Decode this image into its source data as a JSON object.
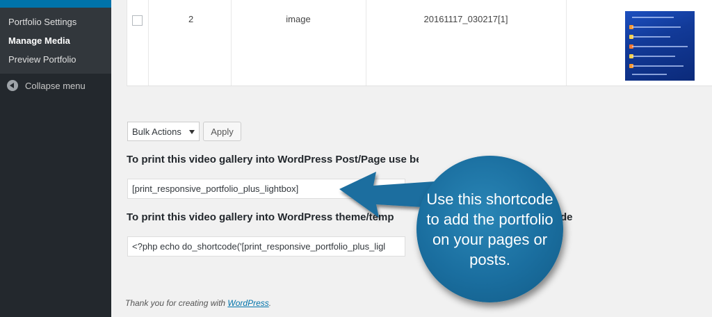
{
  "sidebar": {
    "submenu": [
      {
        "label": "Portfolio Settings",
        "current": false
      },
      {
        "label": "Manage Media",
        "current": true
      },
      {
        "label": "Preview Portfolio",
        "current": false
      }
    ],
    "collapse_label": "Collapse menu"
  },
  "table": {
    "row": {
      "number": "2",
      "type": "image",
      "title": "20161117_030217[1]"
    }
  },
  "bulk": {
    "select_value": "Bulk Actions",
    "apply_label": "Apply"
  },
  "shortcode": {
    "post_heading": "To print this video gallery into WordPress Post/Page use below co",
    "post_code": "[print_responsive_portfolio_plus_lightbox]",
    "theme_heading": "To print this video gallery into WordPress theme/temp",
    "theme_heading_tail": "de",
    "theme_code": "<?php echo do_shortcode('[print_responsive_portfolio_plus_ligl"
  },
  "footer": {
    "text": "Thank you for creating with ",
    "link": "WordPress",
    "suffix": "."
  },
  "callout": {
    "text": "Use this shortcode to add the portfolio on your pages or posts.",
    "color": "#1a6e9f"
  },
  "colors": {
    "sidebar_bg": "#23282d",
    "submenu_bg": "#32373c",
    "accent": "#0073aa"
  }
}
